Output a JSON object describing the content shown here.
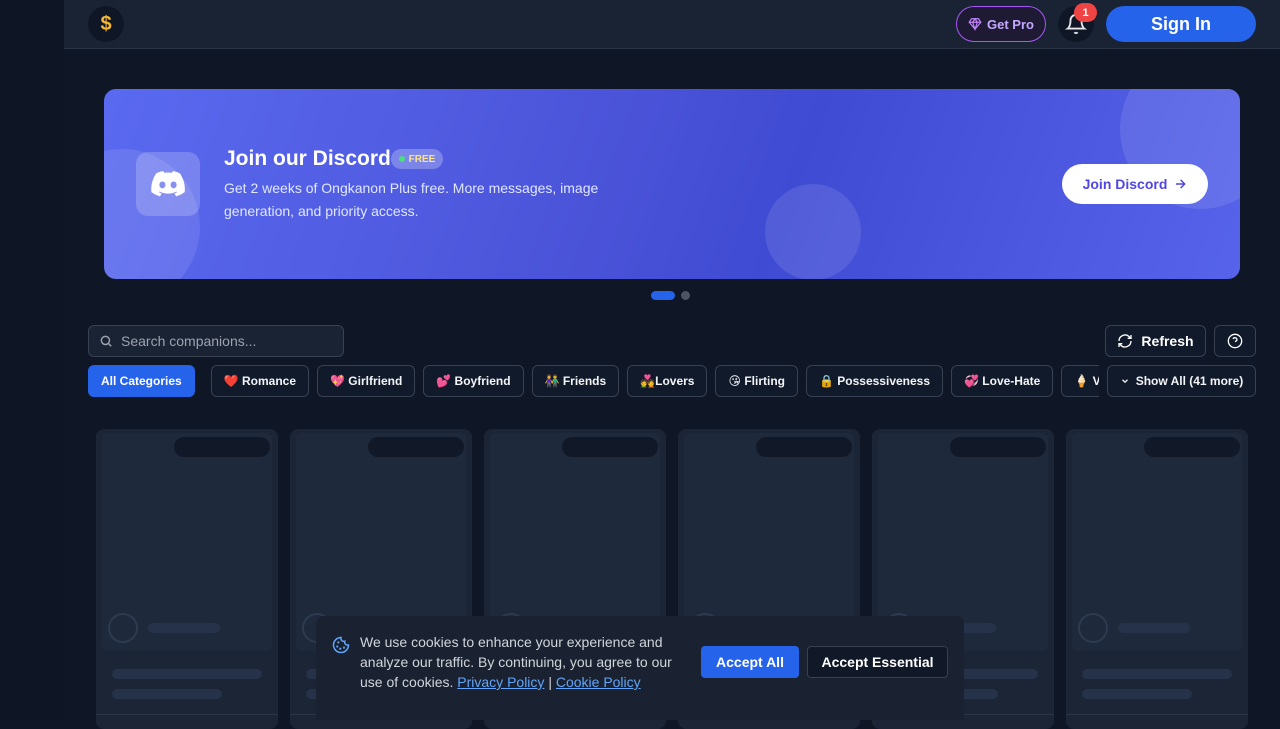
{
  "header": {
    "currency_symbol": "$",
    "get_pro_label": "Get Pro",
    "notification_count": "1",
    "sign_in_label": "Sign In"
  },
  "banner": {
    "title": "Join our Discord",
    "badge": "FREE",
    "description": "Get 2 weeks of Ongkanon Plus free. More messages, image generation, and priority access.",
    "button_label": "Join Discord",
    "slides": 2,
    "active_slide": 1
  },
  "search": {
    "placeholder": "Search companions..."
  },
  "toolbar": {
    "refresh_label": "Refresh",
    "show_all_label": "Show All (41 more)"
  },
  "categories": [
    {
      "label": "All Categories",
      "active": true
    },
    {
      "label": "❤️ Romance"
    },
    {
      "label": "💖 Girlfriend"
    },
    {
      "label": "💕 Boyfriend"
    },
    {
      "label": "👫 Friends"
    },
    {
      "label": "💑Lovers"
    },
    {
      "label": "😘 Flirting"
    },
    {
      "label": "🔒 Possessiveness"
    },
    {
      "label": "💞 Love-Hate"
    },
    {
      "label": "🍦 V"
    }
  ],
  "cookie": {
    "text": "We use cookies to enhance your experience and analyze our traffic. By continuing, you agree to our use of cookies.",
    "privacy_link": "Privacy Policy",
    "separator": "|",
    "cookie_link": "Cookie Policy",
    "accept_all_label": "Accept All",
    "accept_essential_label": "Accept Essential"
  },
  "colors": {
    "accent": "#2563eb",
    "background": "#0f1727",
    "banner": "#4a53d8",
    "pro": "#a855f7"
  }
}
